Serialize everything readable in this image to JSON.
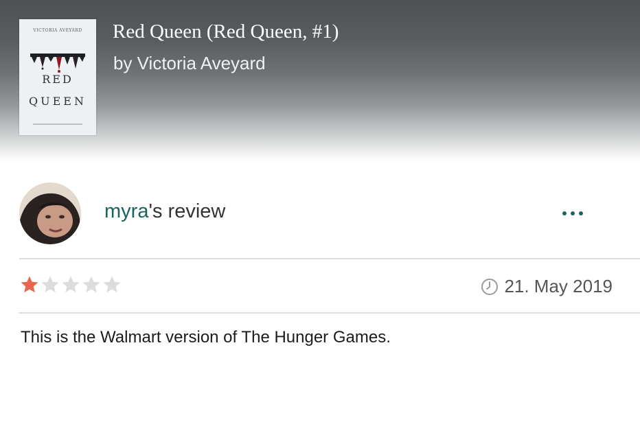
{
  "book": {
    "title": "Red Queen (Red Queen, #1)",
    "author_line": "by Victoria Aveyard",
    "cover": {
      "author_text": "VICTORIA AVEYARD",
      "title_line_1": "RED",
      "title_line_2": "QUEEN"
    }
  },
  "review": {
    "reviewer_name": "myra",
    "heading_suffix": "'s review",
    "rating": {
      "value": 1,
      "max": 5
    },
    "date": "21. May 2019",
    "body": "This is the Walmart version of The Hunger Games."
  },
  "icons": {
    "more": "more-options-icon",
    "clock": "clock-icon",
    "star": "star-icon"
  },
  "colors": {
    "accent": "#19655e",
    "star_filled": "#e8664d",
    "star_empty": "#dcdcdc"
  }
}
